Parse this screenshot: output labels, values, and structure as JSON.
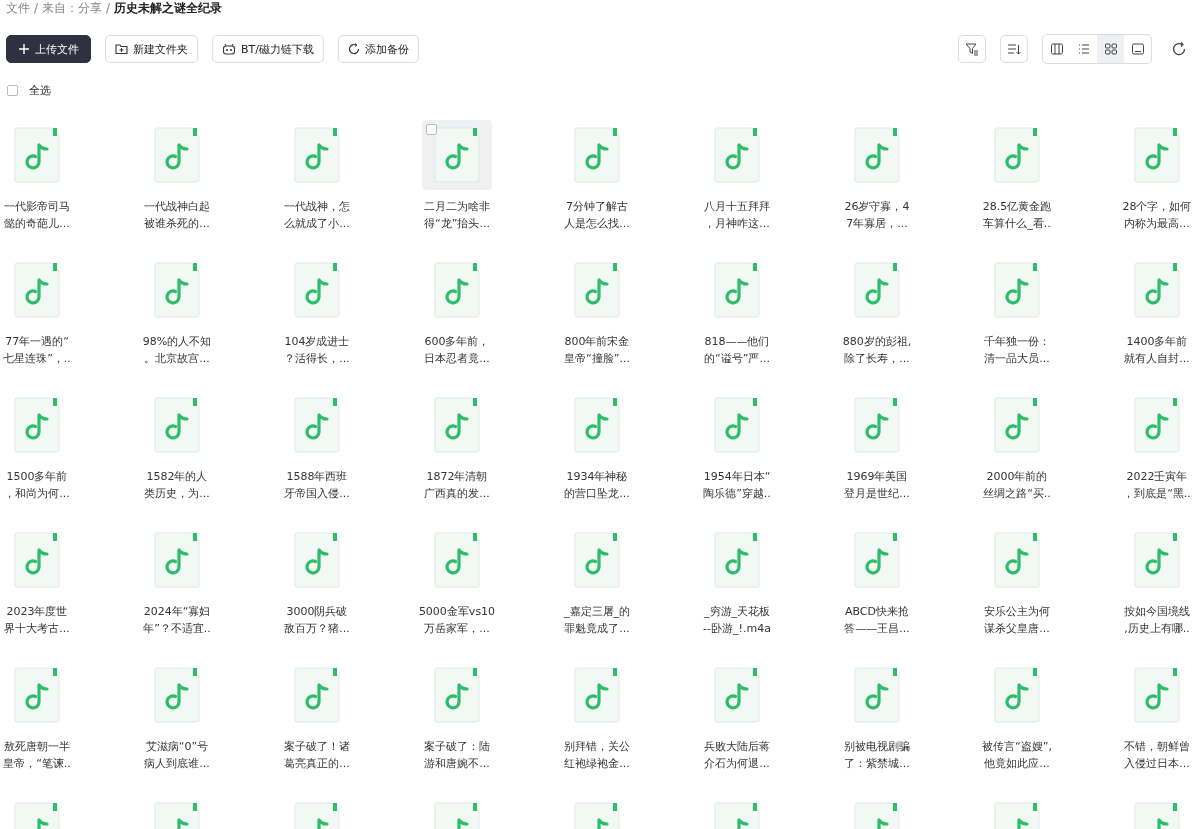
{
  "breadcrumb": [
    {
      "label": "文件",
      "current": false
    },
    {
      "separator": "/",
      "label": "来自：分享",
      "current": false
    },
    {
      "separator": "/",
      "label": "历史未解之谜全纪录",
      "current": true
    }
  ],
  "toolbar": {
    "buttons": [
      {
        "label": "上传文件",
        "kind": "upload"
      },
      {
        "label": "新建文件夹",
        "kind": "folder"
      },
      {
        "label": "BT/磁力链下载",
        "kind": "bt"
      },
      {
        "label": "添加备份",
        "kind": "backup"
      }
    ],
    "views": [
      {
        "kind": "columns",
        "selected": false
      },
      {
        "kind": "list",
        "selected": false
      },
      {
        "kind": "grid",
        "selected": true
      },
      {
        "kind": "preview",
        "selected": false
      }
    ]
  },
  "select_all": {
    "label": "全选",
    "checked": false
  },
  "files": [
    {
      "lines": [
        "一代影帝司马",
        "懿的奇葩儿..."
      ],
      "hovered": false
    },
    {
      "lines": [
        "一代战神白起",
        "被谁杀死的..."
      ],
      "hovered": false
    },
    {
      "lines": [
        "一代战神，怎",
        "么就成了小..."
      ],
      "hovered": false
    },
    {
      "lines": [
        "二月二为啥非",
        "得“龙”抬头..."
      ],
      "hovered": true
    },
    {
      "lines": [
        "7分钟了解古",
        "人是怎么找..."
      ],
      "hovered": false
    },
    {
      "lines": [
        "八月十五拜拜",
        "，月神咋这..."
      ],
      "hovered": false
    },
    {
      "lines": [
        "26岁守寡，4",
        "7年寡居，..."
      ],
      "hovered": false
    },
    {
      "lines": [
        "28.5亿黄金跑",
        "车算什么_看.."
      ],
      "hovered": false
    },
    {
      "lines": [
        "28个字，如何",
        "内称为最高..."
      ],
      "hovered": false
    },
    {
      "lines": [
        "77年一遇的“",
        "七星连珠”，.."
      ],
      "hovered": false
    },
    {
      "lines": [
        "98%的人不知",
        "。北京故宫..."
      ],
      "hovered": false
    },
    {
      "lines": [
        "104岁成进士",
        "？活得长，..."
      ],
      "hovered": false
    },
    {
      "lines": [
        "600多年前，",
        "日本忍者竟..."
      ],
      "hovered": false
    },
    {
      "lines": [
        "800年前宋金",
        "皇帝“撞脸”..."
      ],
      "hovered": false
    },
    {
      "lines": [
        "818——他们",
        "的“谥号”严..."
      ],
      "hovered": false
    },
    {
      "lines": [
        "880岁的彭祖,",
        "除了长寿，..."
      ],
      "hovered": false
    },
    {
      "lines": [
        "千年独一份：",
        "清一品大员..."
      ],
      "hovered": false
    },
    {
      "lines": [
        "1400多年前",
        "就有人自封..."
      ],
      "hovered": false
    },
    {
      "lines": [
        "1500多年前",
        "，和尚为何..."
      ],
      "hovered": false
    },
    {
      "lines": [
        "1582年的人",
        "类历史，为..."
      ],
      "hovered": false
    },
    {
      "lines": [
        "1588年西班",
        "牙帝国入侵..."
      ],
      "hovered": false
    },
    {
      "lines": [
        "1872年清朝",
        "广西真的发..."
      ],
      "hovered": false
    },
    {
      "lines": [
        "1934年神秘",
        "的营口坠龙..."
      ],
      "hovered": false
    },
    {
      "lines": [
        "1954年日本“",
        "陶乐德”穿越.."
      ],
      "hovered": false
    },
    {
      "lines": [
        "1969年美国",
        "登月是世纪..."
      ],
      "hovered": false
    },
    {
      "lines": [
        "2000年前的",
        "丝绸之路“买.."
      ],
      "hovered": false
    },
    {
      "lines": [
        "2022壬寅年",
        "，到底是“黑.."
      ],
      "hovered": false
    },
    {
      "lines": [
        "2023年度世",
        "界十大考古..."
      ],
      "hovered": false
    },
    {
      "lines": [
        "2024年“寡妇",
        "年”？不适宜.."
      ],
      "hovered": false
    },
    {
      "lines": [
        "3000阴兵破",
        "敌百万？猪..."
      ],
      "hovered": false
    },
    {
      "lines": [
        "5000金军vs10",
        "万岳家军，..."
      ],
      "hovered": false
    },
    {
      "lines": [
        "_嘉定三屠_的",
        "罪魁竟成了..."
      ],
      "hovered": false
    },
    {
      "lines": [
        "_穷游_天花板",
        "--卧游_!.m4a"
      ],
      "hovered": false
    },
    {
      "lines": [
        "ABCD快来抢",
        "答——王昌..."
      ],
      "hovered": false
    },
    {
      "lines": [
        "安乐公主为何",
        "谋杀父皇唐..."
      ],
      "hovered": false
    },
    {
      "lines": [
        "按如今国境线",
        ",历史上有哪.."
      ],
      "hovered": false
    },
    {
      "lines": [
        "敖死唐朝一半",
        "皇帝，“笔谏.."
      ],
      "hovered": false
    },
    {
      "lines": [
        "艾滋病“0”号",
        "病人到底谁..."
      ],
      "hovered": false
    },
    {
      "lines": [
        "案子破了！诸",
        "葛亮真正的..."
      ],
      "hovered": false
    },
    {
      "lines": [
        "案子破了：陆",
        "游和唐婉不..."
      ],
      "hovered": false
    },
    {
      "lines": [
        "别拜错，关公",
        "红袍绿袍金..."
      ],
      "hovered": false
    },
    {
      "lines": [
        "兵败大陆后蒋",
        "介石为何退..."
      ],
      "hovered": false
    },
    {
      "lines": [
        "别被电视剧骗",
        "了：紫禁城..."
      ],
      "hovered": false
    },
    {
      "lines": [
        "被传言“盗嫂”,",
        "他竟如此应..."
      ],
      "hovered": false
    },
    {
      "lines": [
        "不错，朝鲜曾",
        "入侵过日本..."
      ],
      "hovered": false
    },
    {
      "hovered": false
    },
    {
      "hovered": false
    },
    {
      "hovered": false
    },
    {
      "hovered": false
    },
    {
      "hovered": false
    },
    {
      "hovered": false
    },
    {
      "hovered": false
    },
    {
      "hovered": false
    },
    {
      "hovered": false
    }
  ]
}
